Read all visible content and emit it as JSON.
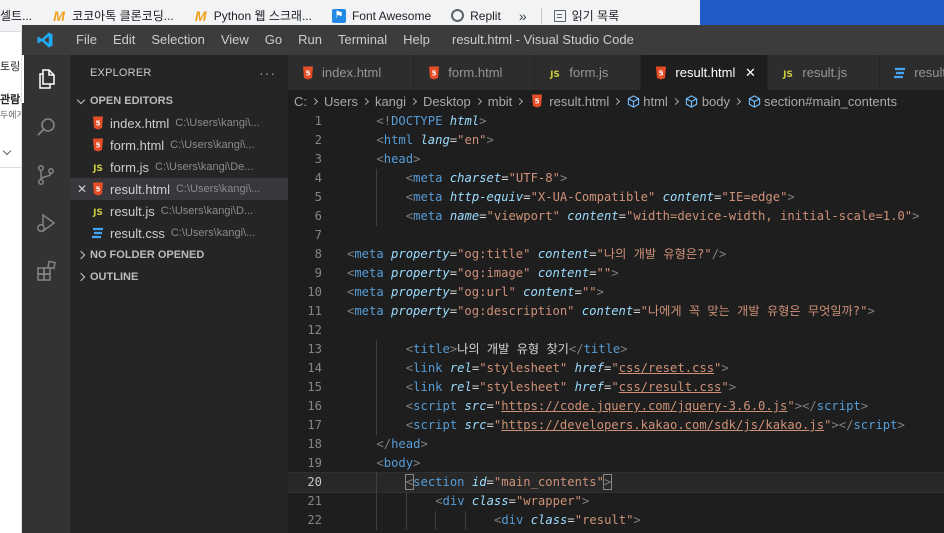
{
  "browser": {
    "bookmarks": [
      {
        "icon": "",
        "label": "셀트..."
      },
      {
        "icon": "m",
        "label": "코코아톡 클론코딩..."
      },
      {
        "icon": "m",
        "label": "Python 웹 스크래..."
      },
      {
        "icon": "fa",
        "label": "Font Awesome"
      },
      {
        "icon": "rp",
        "label": "Replit"
      }
    ],
    "more": "»",
    "reading_list": "읽기 목록",
    "page_texts": [
      "토링",
      "관람(",
      "두에게"
    ]
  },
  "vscode": {
    "title": "result.html - Visual Studio Code",
    "menu": [
      "File",
      "Edit",
      "Selection",
      "View",
      "Go",
      "Run",
      "Terminal",
      "Help"
    ],
    "explorer": {
      "header": "EXPLORER",
      "more": "···",
      "open_editors_label": "OPEN EDITORS",
      "open_editors": [
        {
          "name": "index.html",
          "path": "C:\\Users\\kangi\\...",
          "type": "html",
          "selected": false
        },
        {
          "name": "form.html",
          "path": "C:\\Users\\kangi\\...",
          "type": "html",
          "selected": false
        },
        {
          "name": "form.js",
          "path": "C:\\Users\\kangi\\De...",
          "type": "js",
          "selected": false
        },
        {
          "name": "result.html",
          "path": "C:\\Users\\kangi\\...",
          "type": "html",
          "selected": true
        },
        {
          "name": "result.js",
          "path": "C:\\Users\\kangi\\D...",
          "type": "js",
          "selected": false
        },
        {
          "name": "result.css",
          "path": "C:\\Users\\kangi\\...",
          "type": "css",
          "selected": false
        }
      ],
      "no_folder": "NO FOLDER OPENED",
      "outline": "OUTLINE"
    },
    "tabs": [
      {
        "name": "index.html",
        "type": "html",
        "active": false
      },
      {
        "name": "form.html",
        "type": "html",
        "active": false
      },
      {
        "name": "form.js",
        "type": "js",
        "active": false
      },
      {
        "name": "result.html",
        "type": "html",
        "active": true
      },
      {
        "name": "result.js",
        "type": "js",
        "active": false
      },
      {
        "name": "result.css",
        "type": "css",
        "active": false
      }
    ],
    "breadcrumbs": [
      "C:",
      "Users",
      "kangi",
      "Desktop",
      "mbit",
      "result.html",
      "html",
      "body",
      "section#main_contents"
    ],
    "current_line": 20,
    "code_lines": [
      {
        "n": 1,
        "indent": 4,
        "tokens": [
          [
            "br",
            "<!"
          ],
          [
            "tag",
            "DOCTYPE"
          ],
          [
            "t",
            " "
          ],
          [
            "attr",
            "html"
          ],
          [
            "br",
            ">"
          ]
        ]
      },
      {
        "n": 2,
        "indent": 4,
        "tokens": [
          [
            "br",
            "<"
          ],
          [
            "tag",
            "html"
          ],
          [
            "t",
            " "
          ],
          [
            "attr",
            "lang"
          ],
          [
            "t",
            "="
          ],
          [
            "str",
            "\"en\""
          ],
          [
            "br",
            ">"
          ]
        ]
      },
      {
        "n": 3,
        "indent": 4,
        "tokens": [
          [
            "br",
            "<"
          ],
          [
            "tag",
            "head"
          ],
          [
            "br",
            ">"
          ]
        ]
      },
      {
        "n": 4,
        "indent": 8,
        "tokens": [
          [
            "br",
            "<"
          ],
          [
            "tag",
            "meta"
          ],
          [
            "t",
            " "
          ],
          [
            "attr",
            "charset"
          ],
          [
            "t",
            "="
          ],
          [
            "str",
            "\"UTF-8\""
          ],
          [
            "br",
            ">"
          ]
        ]
      },
      {
        "n": 5,
        "indent": 8,
        "tokens": [
          [
            "br",
            "<"
          ],
          [
            "tag",
            "meta"
          ],
          [
            "t",
            " "
          ],
          [
            "attr",
            "http-equiv"
          ],
          [
            "t",
            "="
          ],
          [
            "str",
            "\"X-UA-Compatible\""
          ],
          [
            "t",
            " "
          ],
          [
            "attr",
            "content"
          ],
          [
            "t",
            "="
          ],
          [
            "str",
            "\"IE=edge\""
          ],
          [
            "br",
            ">"
          ]
        ]
      },
      {
        "n": 6,
        "indent": 8,
        "tokens": [
          [
            "br",
            "<"
          ],
          [
            "tag",
            "meta"
          ],
          [
            "t",
            " "
          ],
          [
            "attr",
            "name"
          ],
          [
            "t",
            "="
          ],
          [
            "str",
            "\"viewport\""
          ],
          [
            "t",
            " "
          ],
          [
            "attr",
            "content"
          ],
          [
            "t",
            "="
          ],
          [
            "str",
            "\"width=device-width, initial-scale=1.0\""
          ],
          [
            "br",
            ">"
          ]
        ]
      },
      {
        "n": 7,
        "indent": 0,
        "tokens": []
      },
      {
        "n": 8,
        "indent": 0,
        "tokens": [
          [
            "br",
            "<"
          ],
          [
            "tag",
            "meta"
          ],
          [
            "t",
            " "
          ],
          [
            "attr",
            "property"
          ],
          [
            "t",
            "="
          ],
          [
            "str",
            "\"og:title\""
          ],
          [
            "t",
            " "
          ],
          [
            "attr",
            "content"
          ],
          [
            "t",
            "="
          ],
          [
            "str",
            "\"나의 개발 유형은?\""
          ],
          [
            "br",
            "/>"
          ]
        ]
      },
      {
        "n": 9,
        "indent": 0,
        "tokens": [
          [
            "br",
            "<"
          ],
          [
            "tag",
            "meta"
          ],
          [
            "t",
            " "
          ],
          [
            "attr",
            "property"
          ],
          [
            "t",
            "="
          ],
          [
            "str",
            "\"og:image\""
          ],
          [
            "t",
            " "
          ],
          [
            "attr",
            "content"
          ],
          [
            "t",
            "="
          ],
          [
            "str",
            "\"\""
          ],
          [
            "br",
            ">"
          ]
        ]
      },
      {
        "n": 10,
        "indent": 0,
        "tokens": [
          [
            "br",
            "<"
          ],
          [
            "tag",
            "meta"
          ],
          [
            "t",
            " "
          ],
          [
            "attr",
            "property"
          ],
          [
            "t",
            "="
          ],
          [
            "str",
            "\"og:url\""
          ],
          [
            "t",
            " "
          ],
          [
            "attr",
            "content"
          ],
          [
            "t",
            "="
          ],
          [
            "str",
            "\"\""
          ],
          [
            "br",
            ">"
          ]
        ]
      },
      {
        "n": 11,
        "indent": 0,
        "tokens": [
          [
            "br",
            "<"
          ],
          [
            "tag",
            "meta"
          ],
          [
            "t",
            " "
          ],
          [
            "attr",
            "property"
          ],
          [
            "t",
            "="
          ],
          [
            "str",
            "\"og:description\""
          ],
          [
            "t",
            " "
          ],
          [
            "attr",
            "content"
          ],
          [
            "t",
            "="
          ],
          [
            "str",
            "\"나에게 꼭 맞는 개발 유형은 무엇일까?\""
          ],
          [
            "br",
            ">"
          ]
        ]
      },
      {
        "n": 12,
        "indent": 0,
        "tokens": []
      },
      {
        "n": 13,
        "indent": 8,
        "tokens": [
          [
            "br",
            "<"
          ],
          [
            "tag",
            "title"
          ],
          [
            "br",
            ">"
          ],
          [
            "t",
            "나의 개발 유형 찾기"
          ],
          [
            "br",
            "</"
          ],
          [
            "tag",
            "title"
          ],
          [
            "br",
            ">"
          ]
        ]
      },
      {
        "n": 14,
        "indent": 8,
        "tokens": [
          [
            "br",
            "<"
          ],
          [
            "tag",
            "link"
          ],
          [
            "t",
            " "
          ],
          [
            "attr",
            "rel"
          ],
          [
            "t",
            "="
          ],
          [
            "str",
            "\"stylesheet\""
          ],
          [
            "t",
            " "
          ],
          [
            "attr",
            "href"
          ],
          [
            "t",
            "="
          ],
          [
            "str",
            "\""
          ],
          [
            "link",
            "css/reset.css"
          ],
          [
            "str",
            "\""
          ],
          [
            "br",
            ">"
          ]
        ]
      },
      {
        "n": 15,
        "indent": 8,
        "tokens": [
          [
            "br",
            "<"
          ],
          [
            "tag",
            "link"
          ],
          [
            "t",
            " "
          ],
          [
            "attr",
            "rel"
          ],
          [
            "t",
            "="
          ],
          [
            "str",
            "\"stylesheet\""
          ],
          [
            "t",
            " "
          ],
          [
            "attr",
            "href"
          ],
          [
            "t",
            "="
          ],
          [
            "str",
            "\""
          ],
          [
            "link",
            "css/result.css"
          ],
          [
            "str",
            "\""
          ],
          [
            "br",
            ">"
          ]
        ]
      },
      {
        "n": 16,
        "indent": 8,
        "tokens": [
          [
            "br",
            "<"
          ],
          [
            "tag",
            "script"
          ],
          [
            "t",
            " "
          ],
          [
            "attr",
            "src"
          ],
          [
            "t",
            "="
          ],
          [
            "str",
            "\""
          ],
          [
            "link",
            "https://code.jquery.com/jquery-3.6.0.js"
          ],
          [
            "str",
            "\""
          ],
          [
            "br",
            "></"
          ],
          [
            "tag",
            "script"
          ],
          [
            "br",
            ">"
          ]
        ]
      },
      {
        "n": 17,
        "indent": 8,
        "tokens": [
          [
            "br",
            "<"
          ],
          [
            "tag",
            "script"
          ],
          [
            "t",
            " "
          ],
          [
            "attr",
            "src"
          ],
          [
            "t",
            "="
          ],
          [
            "str",
            "\""
          ],
          [
            "link",
            "https://developers.kakao.com/sdk/js/kakao.js"
          ],
          [
            "str",
            "\""
          ],
          [
            "br",
            "></"
          ],
          [
            "tag",
            "script"
          ],
          [
            "br",
            ">"
          ]
        ]
      },
      {
        "n": 18,
        "indent": 4,
        "tokens": [
          [
            "br",
            "</"
          ],
          [
            "tag",
            "head"
          ],
          [
            "br",
            ">"
          ]
        ]
      },
      {
        "n": 19,
        "indent": 4,
        "tokens": [
          [
            "br",
            "<"
          ],
          [
            "tag",
            "body"
          ],
          [
            "br",
            ">"
          ]
        ]
      },
      {
        "n": 20,
        "indent": 8,
        "tokens": [
          [
            "brm",
            "<"
          ],
          [
            "tag",
            "section"
          ],
          [
            "t",
            " "
          ],
          [
            "attr",
            "id"
          ],
          [
            "t",
            "="
          ],
          [
            "str",
            "\"main_contents\""
          ],
          [
            "brm",
            ">"
          ]
        ]
      },
      {
        "n": 21,
        "indent": 12,
        "tokens": [
          [
            "br",
            "<"
          ],
          [
            "tag",
            "div"
          ],
          [
            "t",
            " "
          ],
          [
            "attr",
            "class"
          ],
          [
            "t",
            "="
          ],
          [
            "str",
            "\"wrapper\""
          ],
          [
            "br",
            ">"
          ]
        ]
      },
      {
        "n": 22,
        "indent": 20,
        "tokens": [
          [
            "br",
            "<"
          ],
          [
            "tag",
            "div"
          ],
          [
            "t",
            " "
          ],
          [
            "attr",
            "class"
          ],
          [
            "t",
            "="
          ],
          [
            "str",
            "\"result\""
          ],
          [
            "br",
            ">"
          ]
        ]
      }
    ]
  },
  "colors": {
    "html_icon": "#e44d26",
    "js_icon": "#cbcb41",
    "css_icon": "#42a5f5",
    "vscode_blue": "#23a9f2"
  }
}
